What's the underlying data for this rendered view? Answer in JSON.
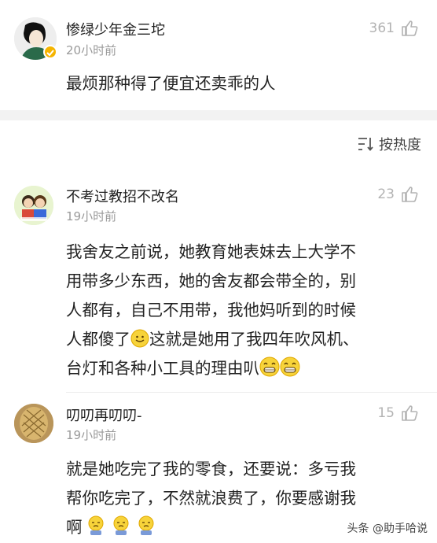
{
  "post": {
    "author": "惨绿少年金三坨",
    "time": "20小时前",
    "likes": "361",
    "text": "最烦那种得了便宜还卖乖的人"
  },
  "sort": {
    "label": "按热度"
  },
  "comments": [
    {
      "author": "不考过教招不改名",
      "time": "19小时前",
      "likes": "23",
      "text_lines": [
        "我舍友之前说，她教育她表妹去上大学不",
        "用带多少东西，她的舍友都会带全的，别",
        "人都有，自己不用带，我他妈听到的时候",
        "人都傻了",
        "这就是她用了我四年吹风机、",
        "台灯和各种小工具的理由叭"
      ]
    },
    {
      "author": "叨叨再叨叨-",
      "time": "19小时前",
      "likes": "15",
      "text_lines": [
        "就是她吃完了我的零食，还要说：多亏我",
        "帮你吃完了，不然就浪费了，你要感谢我",
        "啊"
      ]
    }
  ],
  "watermark": "头条 @助手哈说",
  "icons": {
    "thumb": "thumbs-up-icon",
    "sort": "sort-icon",
    "smile": "smile-emoji",
    "grin": "grin-emoji",
    "sad": "sad-emoji",
    "verified": "verified-badge-icon"
  },
  "colors": {
    "verified": "#f5b400",
    "muted": "#9a9a9a",
    "likes": "#b3b3b3"
  }
}
